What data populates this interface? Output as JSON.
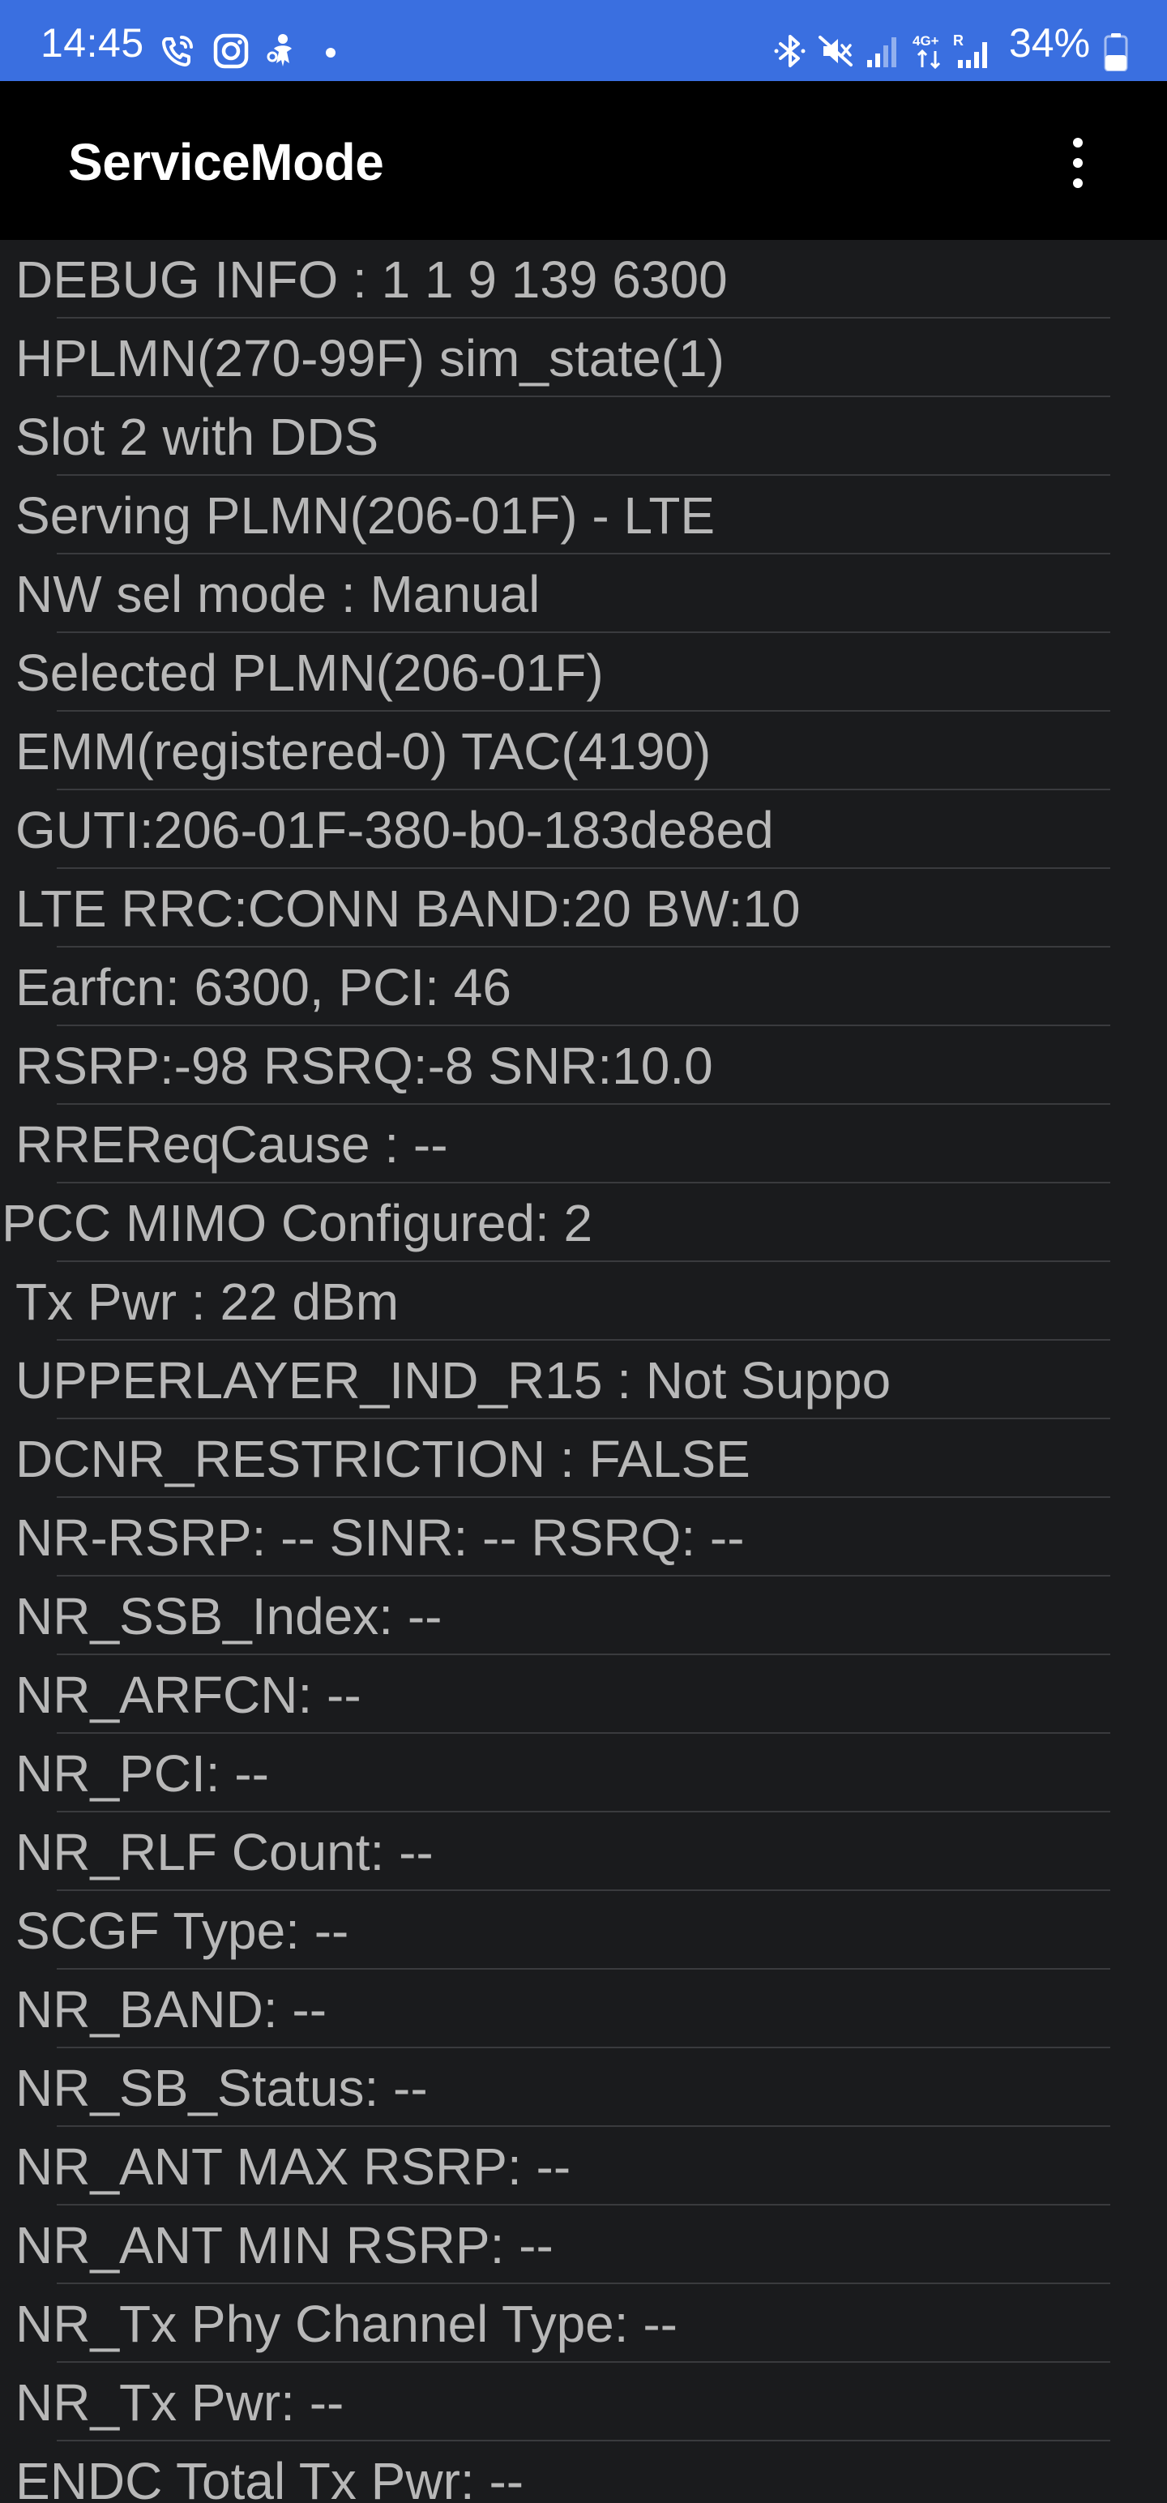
{
  "status_bar": {
    "time": "14:45",
    "battery_percent": "34%",
    "left_icons": [
      "wifi-calling-icon",
      "instagram-icon",
      "threads-icon",
      "notification-dot-icon"
    ],
    "right_icons": [
      "bluetooth-icon",
      "mute-icon",
      "signal-icon",
      "4g-plus-data-icon",
      "roaming-signal-icon",
      "battery-icon"
    ],
    "colors": {
      "background": "#3a6fe0",
      "foreground": "#ffffff"
    }
  },
  "app_bar": {
    "title": "ServiceMode",
    "menu_icon": "more-vert-icon"
  },
  "info_rows": [
    {
      "text": "DEBUG INFO : 1 1 9 139 6300"
    },
    {
      "text": "HPLMN(270-99F) sim_state(1)"
    },
    {
      "text": "Slot 2 with DDS"
    },
    {
      "text": "Serving PLMN(206-01F) - LTE"
    },
    {
      "text": "NW sel mode : Manual"
    },
    {
      "text": "Selected PLMN(206-01F)"
    },
    {
      "text": "EMM(registered-0) TAC(4190)"
    },
    {
      "text": "GUTI:206-01F-380-b0-183de8ed"
    },
    {
      "text": "LTE RRC:CONN BAND:20 BW:10"
    },
    {
      "text": "Earfcn: 6300, PCI: 46"
    },
    {
      "text": "RSRP:-98 RSRQ:-8 SNR:10.0"
    },
    {
      "text": "RREReqCause : --"
    },
    {
      "text": "PCC MIMO Configured: 2"
    },
    {
      "text": "Tx Pwr : 22 dBm"
    },
    {
      "text": "UPPERLAYER_IND_R15 : Not Suppo"
    },
    {
      "text": "DCNR_RESTRICTION : FALSE"
    },
    {
      "text": "NR-RSRP: -- SINR: -- RSRQ: --"
    },
    {
      "text": "NR_SSB_Index: --"
    },
    {
      "text": "NR_ARFCN: --"
    },
    {
      "text": "NR_PCI: --"
    },
    {
      "text": "NR_RLF Count: --"
    },
    {
      "text": "SCGF Type: --"
    },
    {
      "text": "NR_BAND: --"
    },
    {
      "text": "NR_SB_Status: --"
    },
    {
      "text": "NR_ANT MAX RSRP: --"
    },
    {
      "text": "NR_ANT MIN RSRP: --"
    },
    {
      "text": "NR_Tx Phy Channel Type: --"
    },
    {
      "text": "NR_Tx Pwr: --"
    },
    {
      "text": "ENDC Total Tx Pwr: --"
    }
  ],
  "colors": {
    "app_bar_background": "#000000",
    "list_background": "#1a1b1d",
    "row_text": "#b8b8b8",
    "divider": "#3a3b3e"
  }
}
